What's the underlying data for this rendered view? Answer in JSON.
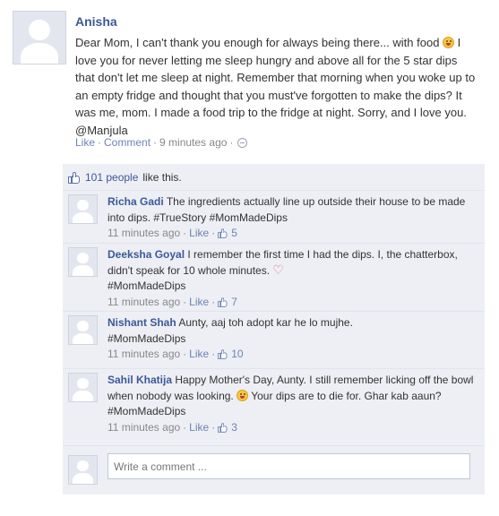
{
  "post": {
    "author": "Anisha",
    "text_parts": [
      "Dear Mom, I can't thank you enough for always being there... with food ",
      " I love you for never letting me sleep hungry and above all for the 5 star dips that don't let me sleep at night. Remember that morning when you woke up to an empty fridge and thought that you must've forgotten to make the dips? It was me, mom. I made a food trip to the fridge at night. Sorry, and I love you. @Manjula"
    ],
    "emoji_icon": "tongue-out-smiley-icon",
    "actions": {
      "like": "Like",
      "sep1": "·",
      "comment": "Comment",
      "sep2": "·",
      "time": "9 minutes ago",
      "sep3": "·",
      "globe_icon": "globe-icon"
    }
  },
  "likes": {
    "count_label": "101 people",
    "suffix": "like this."
  },
  "comments": [
    {
      "author": "Richa Gadi",
      "text": "The ingredients actually line up outside their house to be made into dips. #TrueStory #MomMadeDips",
      "time": "11 minutes ago",
      "like": "Like",
      "likes": "5"
    },
    {
      "author": "Deeksha Goyal",
      "text": "I remember the first time I had the dips. I, the chatterbox, didn't speak for 10 whole minutes.",
      "text_after": "#MomMadeDips",
      "emoji_icon": "heart-icon",
      "time": "11 minutes ago",
      "like": "Like",
      "likes": "7"
    },
    {
      "author": "Nishant Shah",
      "text": "Aunty, aaj toh adopt kar he lo mujhe. #MomMadeDips",
      "time": "11 minutes ago",
      "like": "Like",
      "likes": "10"
    },
    {
      "author": "Sahil Khatija",
      "text": "Happy Mother's Day, Aunty. I still remember licking off the bowl when nobody was looking.",
      "text_after": "Your dips are to die for. Ghar kab aaun? #MomMadeDips",
      "emoji_icon": "tongue-out-smiley-icon",
      "time": "11 minutes ago",
      "like": "Like",
      "likes": "3"
    }
  ],
  "write_comment": {
    "placeholder": "Write a comment ..."
  },
  "colors": {
    "link": "#3b5998",
    "ufi_background": "#edeff4",
    "meta_text": "#888888"
  }
}
